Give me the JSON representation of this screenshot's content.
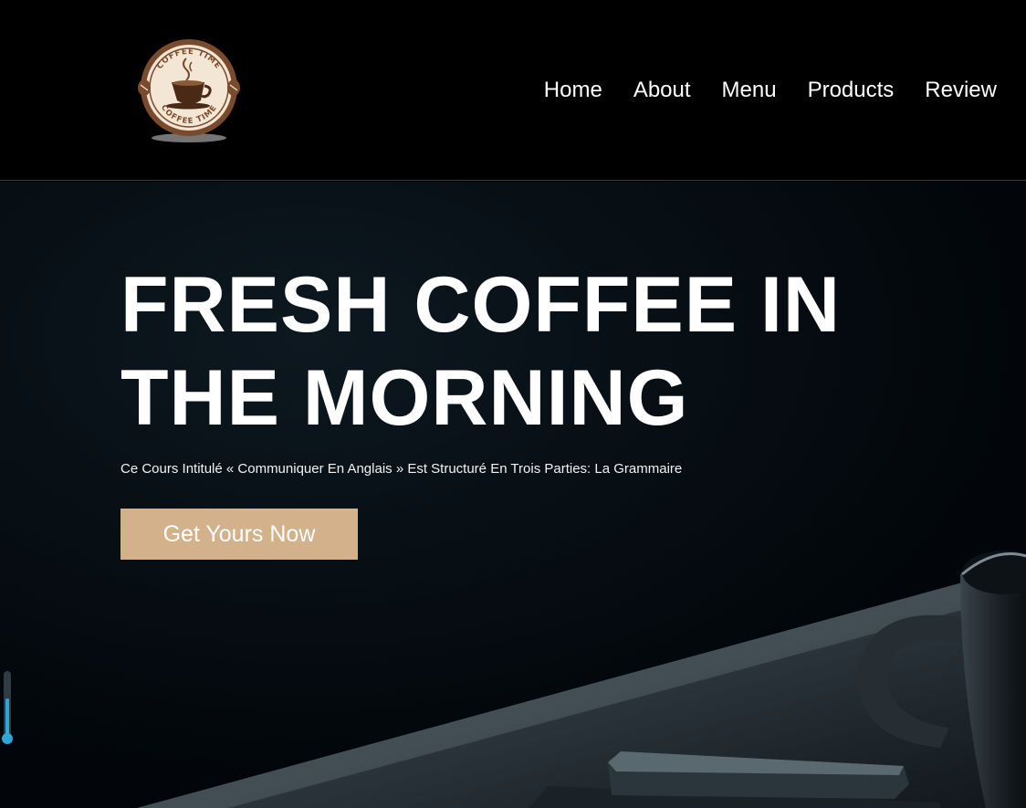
{
  "header": {
    "logo": {
      "icon": "coffee-cup-logo",
      "ring_text": "COFFEE TIME",
      "colors": {
        "ring": "#7a4a2c",
        "fill": "#f4e6d4",
        "coffee": "#4a2a16"
      }
    },
    "nav": [
      {
        "label": "Home"
      },
      {
        "label": "About"
      },
      {
        "label": "Menu"
      },
      {
        "label": "Products"
      },
      {
        "label": "Review"
      }
    ]
  },
  "hero": {
    "title_line1": "FRESH COFFEE IN",
    "title_line2": "THE MORNING",
    "subtitle": "Ce Cours Intitulé « Communiquer En Anglais » Est Structuré En Trois Parties: La Grammaire",
    "cta_label": "Get Yours Now",
    "background": "dark-coffee-cup-on-table",
    "colors": {
      "cta": "#d3b18a",
      "background": "#03080c"
    }
  },
  "scroll_indicator": {
    "icon": "scroll-progress-icon",
    "color": "#2fa6d8"
  }
}
